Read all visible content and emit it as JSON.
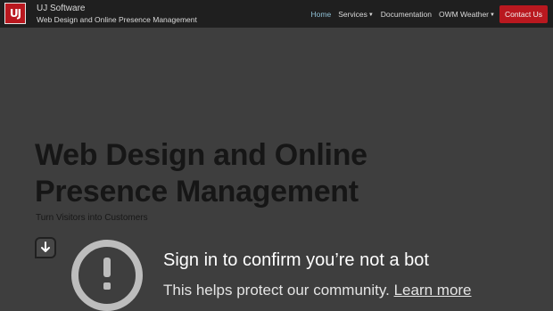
{
  "header": {
    "logo_text": "UJ",
    "brand_name": "UJ Software",
    "brand_tagline": "Web Design and Online Presence Management"
  },
  "nav": {
    "items": [
      {
        "label": "Home",
        "active": true
      },
      {
        "label": "Services",
        "dropdown": true
      },
      {
        "label": "Documentation"
      },
      {
        "label": "OWM Weather",
        "dropdown": true
      }
    ],
    "contact_label": "Contact Us"
  },
  "hero": {
    "title": "Web Design and Online Presence Management",
    "subtitle": "Turn Visitors into Customers"
  },
  "overlay": {
    "title": "Sign in to confirm you’re not a bot",
    "text": "This helps protect our community.",
    "link": "Learn more"
  },
  "colors": {
    "brand_red": "#b9181f",
    "nav_bg": "#1f1f1f",
    "page_bg": "#3e3e3e",
    "active_link": "#8fc0d6"
  },
  "icons": {
    "scroll": "arrow-down-icon",
    "alert": "exclamation-circle-icon"
  }
}
